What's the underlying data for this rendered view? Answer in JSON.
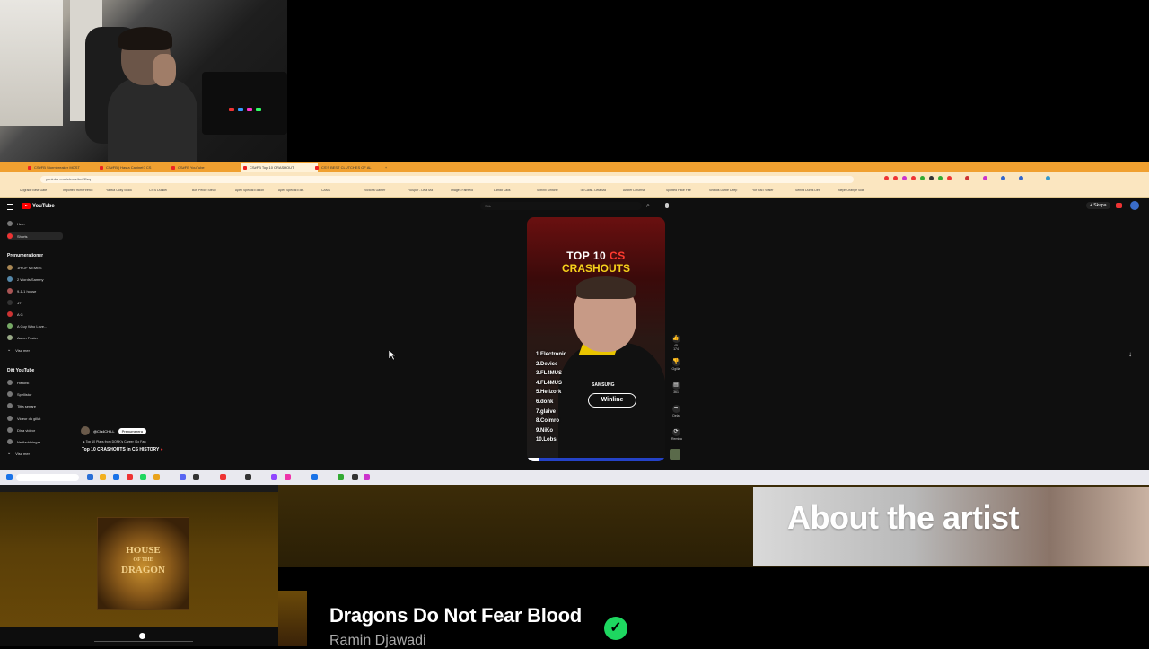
{
  "browser": {
    "tabs": [
      "CS#FB Stormbreaker MOST",
      "CS#FB | Has a Cabinet? CS",
      "CS#FB YouTube",
      "CS#FB Top 10 CRASHOUT",
      "CS'S BEST CLUTCHES OF AL"
    ],
    "url": "youtube.com/shorts/bnFReq",
    "bookmarks": [
      "Upgrade Beta Gate",
      "Imported from Firefox",
      "Yawca Cosy Stock",
      "CS:S Dunkel",
      "Bos Pelice Steup",
      "Apex Special Edition",
      "Apex Special Editi.",
      "CAMS",
      "Victoria Gamer",
      "FluSpur - Leta Ma",
      "Images Fairfield",
      "Lamat Calls",
      "Sphinx Sinforte",
      "Tal Calls - Leta Ma",
      "Amber Lorumse",
      "Spotted Fake Fee",
      "Shields Darbe Deep",
      "Yor Ral I Water",
      "Senha Durbs Det",
      "Neph Orange Side"
    ]
  },
  "youtube": {
    "logo": "YouTube",
    "search_placeholder": "Sök",
    "sidebar": {
      "nav": [
        "Hem",
        "Shorts"
      ],
      "subscriptions_title": "Prenumerationer",
      "subscriptions": [
        "1H OF MEMES",
        "2 Words Sammy",
        "9-1-1 house",
        "47",
        "A G",
        "A Guy Who Love...",
        "Aaron Foster"
      ],
      "show_more": "Visa mer",
      "you_title": "Ditt YouTube",
      "you_items": [
        "Historik",
        "Spellistor",
        "Titta senare",
        "Videor du gillat",
        "Dina videor",
        "Nedladdningar"
      ],
      "show_more2": "Visa mer"
    },
    "short": {
      "heading_white": "TOP 10",
      "heading_red": "CS",
      "heading_yellow": "CRASHOUTS",
      "list": [
        "1.Electronic",
        "2.Device",
        "3.FL4MUS",
        "4.FL4MUS",
        "5.Hellzork",
        "6.donk",
        "7.glaive",
        "8.Coimro",
        "9.NiKo",
        "10.Lobs"
      ],
      "sponsor1": "SAMSUNG",
      "sponsor2": "Winline",
      "progress": 0.09
    },
    "actions": [
      {
        "icon": "like-icon",
        "label": "45 174"
      },
      {
        "icon": "dislike-icon",
        "label": "Ogilla"
      },
      {
        "icon": "comment-icon",
        "label": "361"
      },
      {
        "icon": "share-icon",
        "label": "Dela"
      },
      {
        "icon": "remix-icon",
        "label": "Remixa"
      }
    ],
    "channel": {
      "name": "@Cla4CHILL",
      "subscribe": "Prenumerera",
      "related": "Top 10 Plays from DONK's Career (So Far)",
      "title": "Top 10 CRASHOUTS in CS HISTORY"
    }
  },
  "spotify": {
    "album": {
      "line1": "HOUSE",
      "line2": "OF THE",
      "line3": "DRAGON"
    },
    "about_title": "About the artist",
    "track_title": "Dragons Do Not Fear Blood",
    "track_artist": "Ramin Djawadi",
    "liked_icon": "check-icon",
    "green": "#1ed760"
  },
  "colors": {
    "tabbar": "#f0a030",
    "youtube_red": "#ff0000",
    "short_yellow": "#f6d21b"
  }
}
